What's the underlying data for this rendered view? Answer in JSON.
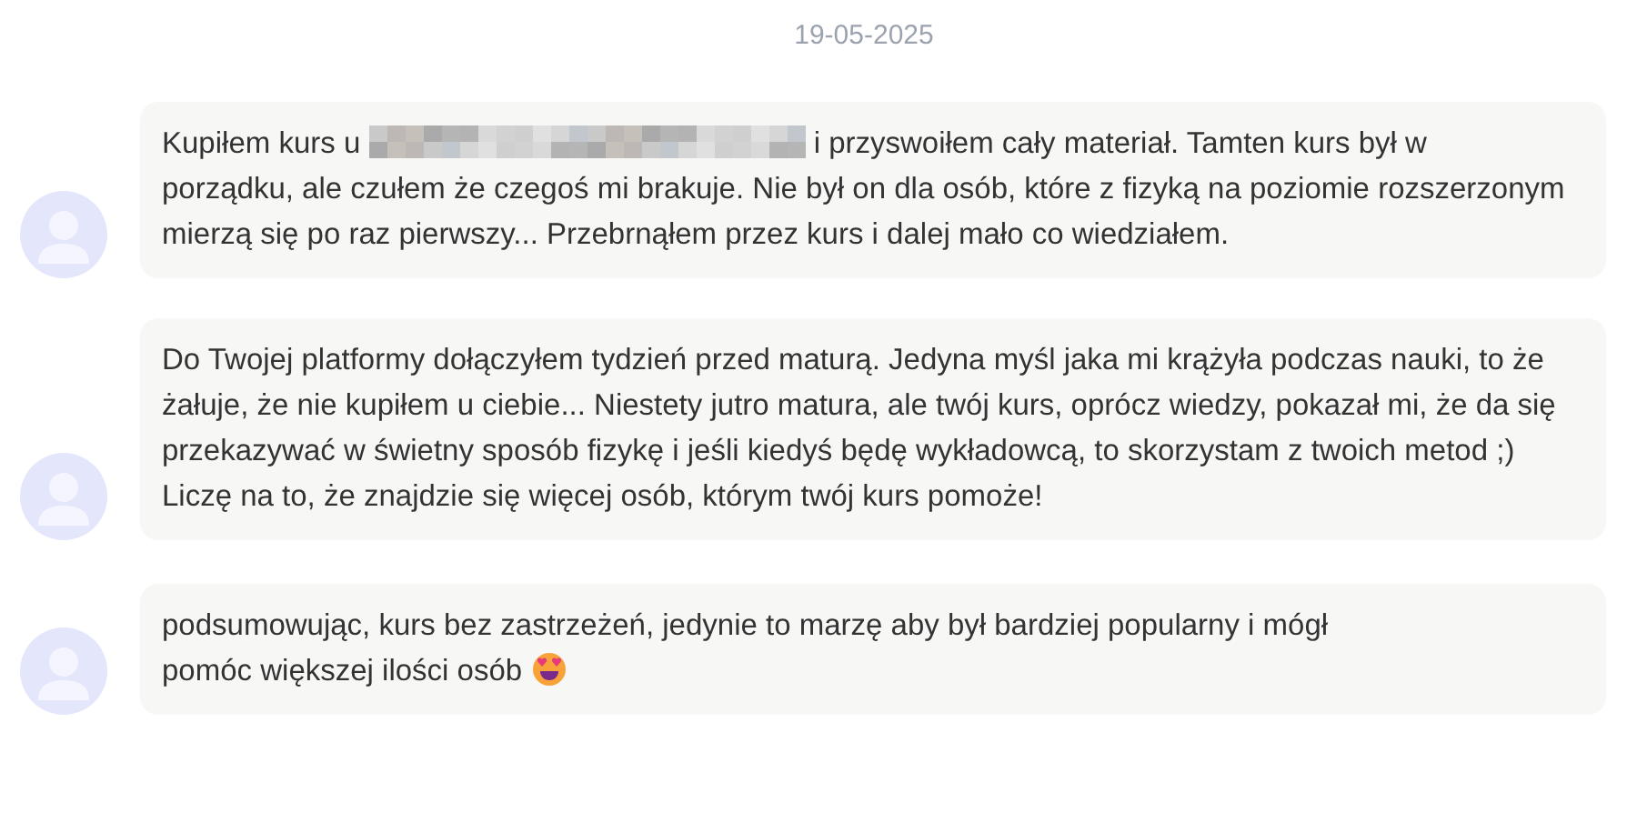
{
  "date": "19-05-2025",
  "messages": [
    {
      "parts": [
        {
          "kind": "text",
          "text": "Kupiłem kurs u"
        },
        {
          "kind": "redacted"
        },
        {
          "kind": "text",
          "text": "i przyswoiłem cały materiał. Tamten kurs był w"
        },
        {
          "kind": "paragraph",
          "text": "porządku, ale czułem że czegoś mi brakuje. Nie był on dla osób, które z fizyką na poziomie rozszerzonym mierzą się po raz pierwszy... Przebrnąłem przez kurs i dalej mało co wiedziałem."
        }
      ]
    },
    {
      "parts": [
        {
          "kind": "paragraph",
          "text": "Do Twojej platformy dołączyłem tydzień przed maturą. Jedyna myśl jaka mi krążyła podczas nauki, to że żałuje, że nie kupiłem u ciebie... Niestety jutro matura, ale twój kurs, oprócz wiedzy, pokazał mi, że da się przekazywać w świetny sposób fizykę i jeśli kiedyś będę wykładowcą, to skorzystam z twoich metod ;) Liczę na to, że znajdzie się więcej osób, którym twój kurs pomoże!"
        }
      ]
    },
    {
      "parts": [
        {
          "kind": "paragraph",
          "text": "podsumowując, kurs bez zastrzeżeń, jedynie to marzę aby był bardziej popularny i mógł"
        },
        {
          "kind": "text",
          "text": "pomóc większej ilości osób"
        },
        {
          "kind": "emoji"
        }
      ]
    }
  ]
}
